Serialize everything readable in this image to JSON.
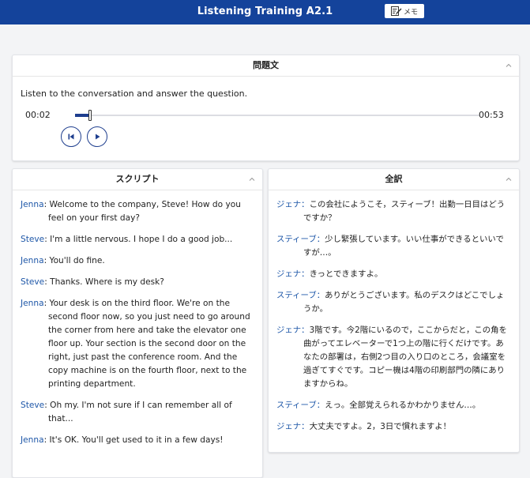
{
  "header": {
    "title": "Listening Training A2.1",
    "memo_label": "メモ"
  },
  "problem": {
    "heading": "問題文",
    "instruction": "Listen to the conversation and answer the question.",
    "current_time": "00:02",
    "total_time": "00:53",
    "progress": 0.038
  },
  "script": {
    "heading": "スクリプト",
    "lines": [
      {
        "speaker": "Jenna",
        "text": "Welcome to the company, Steve! How do you feel on your first day?"
      },
      {
        "speaker": "Steve",
        "text": "I'm a little nervous. I hope I do a good job..."
      },
      {
        "speaker": "Jenna",
        "text": "You'll do fine."
      },
      {
        "speaker": "Steve",
        "text": "Thanks. Where is my desk?"
      },
      {
        "speaker": "Jenna",
        "text": "Your desk is on the third floor. We're on the second floor now, so you just need to go around the corner from here and take the elevator one floor up. Your section is the second door on the right, just past the conference room. And the copy machine is on the fourth floor, next to the printing department."
      },
      {
        "speaker": "Steve",
        "text": "Oh my. I'm not sure if I can remember all of that..."
      },
      {
        "speaker": "Jenna",
        "text": "It's OK. You'll get used to it in a few days!"
      }
    ]
  },
  "translation": {
    "heading": "全訳",
    "lines": [
      {
        "speaker": "ジェナ",
        "text": "この会社にようこそ，スティーブ！出勤一日目はどうですか？"
      },
      {
        "speaker": "スティーブ",
        "text": "少し緊張しています。いい仕事ができるといいですが…。"
      },
      {
        "speaker": "ジェナ",
        "text": "きっとできますよ。"
      },
      {
        "speaker": "スティーブ",
        "text": "ありがとうございます。私のデスクはどこでしょうか。"
      },
      {
        "speaker": "ジェナ",
        "text": "3階です。今2階にいるので，ここからだと，この角を曲がってエレベーターで1つ上の階に行くだけです。あなたの部署は，右側2つ目の入り口のところ，会議室を過ぎてすぐです。コピー機は4階の印刷部門の隣にありますからね。"
      },
      {
        "speaker": "スティーブ",
        "text": "えっ。全部覚えられるかわかりません…。"
      },
      {
        "speaker": "ジェナ",
        "text": "大丈夫ですよ。2，3日で慣れますよ！"
      }
    ]
  },
  "colors": {
    "header_bg": "#14439b",
    "accent": "#1e3e8e",
    "speaker": "#1e57a8"
  },
  "icons": {
    "memo": "edit-note-icon",
    "collapse": "chevron-up-icon",
    "skip_back": "skip-back-icon",
    "play": "play-icon"
  }
}
